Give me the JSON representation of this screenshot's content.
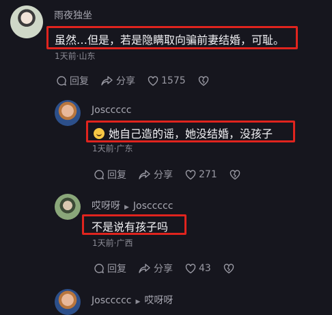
{
  "comments": [
    {
      "user": "雨夜独坐",
      "text": "虽然…但是，若是隐瞒取向骗前妻结婚，可耻。",
      "meta": "1天前·山东",
      "reply_label": "回复",
      "share_label": "分享",
      "likes": "1575"
    },
    {
      "user": "Josccccc",
      "text": "她自己造的谣，她没结婚，没孩子",
      "meta": "1天前·广东",
      "reply_label": "回复",
      "share_label": "分享",
      "likes": "271"
    },
    {
      "user": "哎呀呀",
      "reply_to": "Josccccc",
      "text": "不是说有孩子吗",
      "meta": "1天前·广西",
      "reply_label": "回复",
      "share_label": "分享",
      "likes": "43"
    },
    {
      "user": "Josccccc",
      "reply_to": "哎呀呀"
    }
  ],
  "colors": {
    "highlight": "#e0241e",
    "background": "#16161e"
  }
}
